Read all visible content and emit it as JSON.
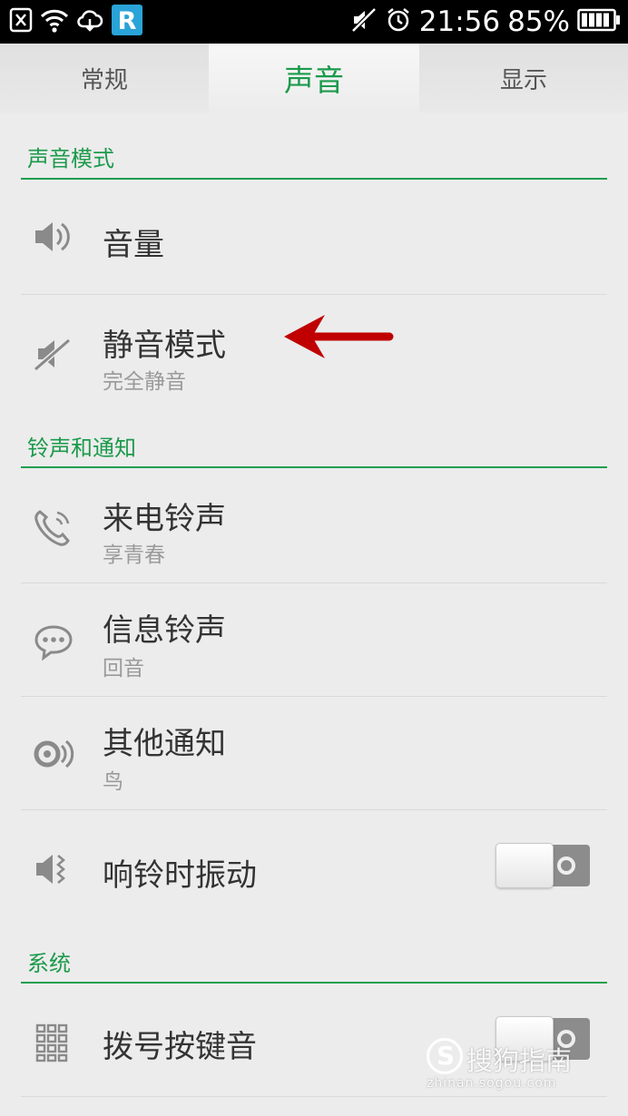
{
  "status_bar": {
    "time": "21:56",
    "battery_percent": "85%",
    "left_icons": [
      "close-box-icon",
      "wifi-icon",
      "cloud-sync-icon",
      "r-app-icon"
    ],
    "r_app_letter": "R",
    "right_icons": [
      "mute-icon",
      "alarm-icon",
      "battery-icon"
    ]
  },
  "tabs": [
    {
      "label": "常规",
      "active": false
    },
    {
      "label": "声音",
      "active": true
    },
    {
      "label": "显示",
      "active": false
    }
  ],
  "sections": {
    "sound_mode": {
      "header": "声音模式",
      "items": [
        {
          "title": "音量",
          "icon": "speaker-icon"
        },
        {
          "title": "静音模式",
          "subtitle": "完全静音",
          "icon": "speaker-muted-icon"
        }
      ]
    },
    "ringtone": {
      "header": "铃声和通知",
      "items": [
        {
          "title": "来电铃声",
          "subtitle": "享青春",
          "icon": "phone-ring-icon"
        },
        {
          "title": "信息铃声",
          "subtitle": "回音",
          "icon": "message-bubble-icon"
        },
        {
          "title": "其他通知",
          "subtitle": "鸟",
          "icon": "notification-sound-icon"
        },
        {
          "title": "响铃时振动",
          "icon": "vibrate-speaker-icon",
          "toggle": "off"
        }
      ]
    },
    "system": {
      "header": "系统",
      "items": [
        {
          "title": "拨号按键音",
          "icon": "dialpad-icon",
          "toggle": "off"
        }
      ]
    }
  },
  "watermark": {
    "logo_letter": "S",
    "text": "搜狗指南",
    "url": "zhinan.sogou.com"
  },
  "colors": {
    "accent": "#1b9a4b",
    "arrow": "#c00000",
    "background": "#ececec"
  }
}
